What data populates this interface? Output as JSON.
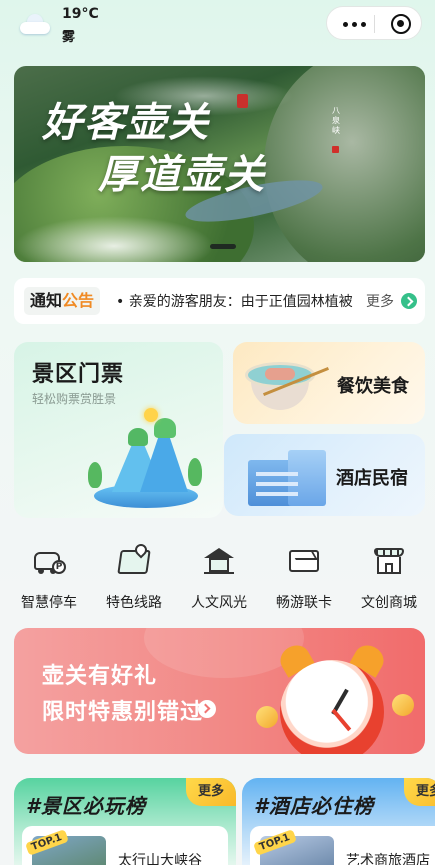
{
  "weather": {
    "temperature": "19°C",
    "condition": "雾",
    "icon": "cloud-icon"
  },
  "capsule": {
    "more_icon": "more-dots-icon",
    "close_icon": "target-circle-icon"
  },
  "banner": {
    "line1": "好客壶关",
    "line2": "厚道壶关",
    "tag": "八泉峡"
  },
  "notice": {
    "badge_part1": "通知",
    "badge_part2": "公告",
    "text": "• 亲爱的游客朋友：由于正值园林植被",
    "more_label": "更多"
  },
  "cards": {
    "tickets": {
      "title": "景区门票",
      "subtitle": "轻松购票赏胜景"
    },
    "food": {
      "label": "餐饮美食"
    },
    "hotel": {
      "label": "酒店民宿"
    }
  },
  "grid": [
    {
      "label": "智慧停车",
      "icon": "parking-car-icon"
    },
    {
      "label": "特色线路",
      "icon": "route-map-icon"
    },
    {
      "label": "人文风光",
      "icon": "pavilion-icon"
    },
    {
      "label": "畅游联卡",
      "icon": "card-envelope-icon"
    },
    {
      "label": "文创商城",
      "icon": "shop-icon"
    }
  ],
  "promo": {
    "line1": "壶关有好礼",
    "line2": "限时特惠别错过"
  },
  "rankings": {
    "scenic": {
      "title": "#景区必玩榜",
      "more": "更多",
      "badge": "TOP.1",
      "item": "太行山大峡谷"
    },
    "hotel": {
      "title": "#酒店必住榜",
      "more": "更多",
      "badge": "TOP.1",
      "item": "艺术商旅酒店"
    }
  },
  "colors": {
    "accent_green": "#35c08a",
    "notice_orange": "#f08a24",
    "promo_red": "#f16b6b"
  }
}
